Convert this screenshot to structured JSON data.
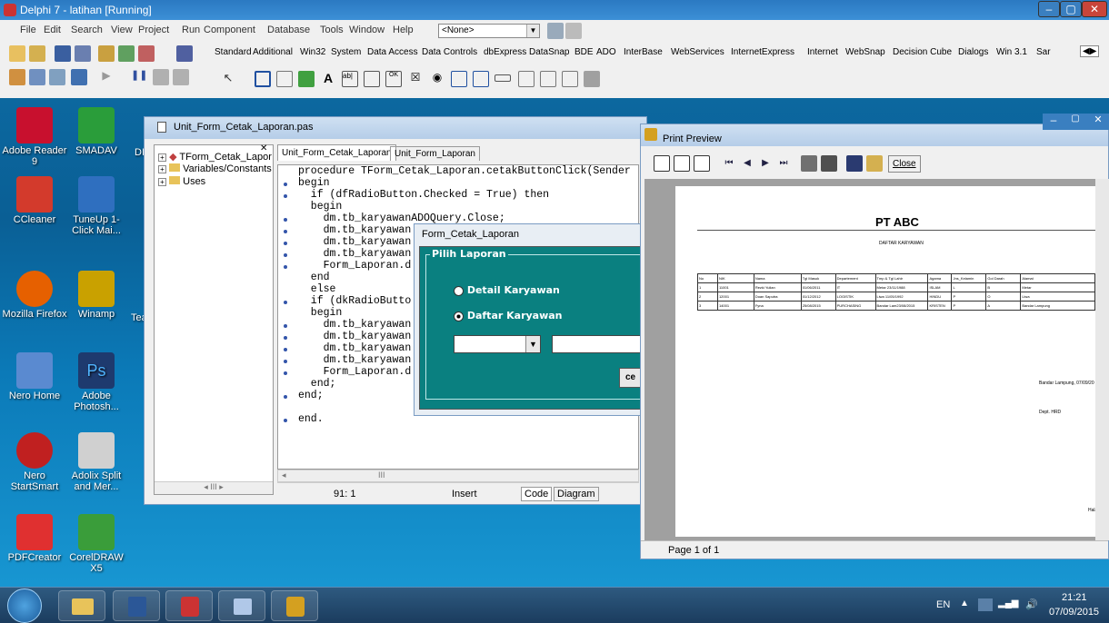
{
  "ide": {
    "title": "Delphi 7 - latihan [Running]",
    "menu": [
      "File",
      "Edit",
      "Search",
      "View",
      "Project",
      "Run",
      "Component",
      "Database",
      "Tools",
      "Window",
      "Help"
    ],
    "desktop_combo": "<None>",
    "palette_tabs": [
      "Standard",
      "Additional",
      "Win32",
      "System",
      "Data Access",
      "Data Controls",
      "dbExpress",
      "DataSnap",
      "BDE",
      "ADO",
      "InterBase",
      "WebServices",
      "InternetExpress",
      "Internet",
      "WebSnap",
      "Decision Cube",
      "Dialogs",
      "Win 3.1",
      "Sar"
    ]
  },
  "desktop_icons": [
    {
      "label": "Adobe Reader 9",
      "color": "#c8102e"
    },
    {
      "label": "SMADAV",
      "color": "#2a9d3a"
    },
    {
      "label": "CCleaner",
      "color": "#d33a2c"
    },
    {
      "label": "TuneUp 1-Click Mai...",
      "color": "#2f6fbf"
    },
    {
      "label": "Mozilla Firefox",
      "color": "#e66000"
    },
    {
      "label": "Winamp",
      "color": "#c9a100"
    },
    {
      "label": "Nero Home",
      "color": "#5a8ad0"
    },
    {
      "label": "Adobe Photosh...",
      "color": "#1e3a6e"
    },
    {
      "label": "Nero StartSmart",
      "color": "#c02020"
    },
    {
      "label": "Adolix Split and Mer...",
      "color": "#d0d0d0"
    },
    {
      "label": "PDFCreator",
      "color": "#e03030"
    },
    {
      "label": "CorelDRAW X5",
      "color": "#3a9d3a"
    }
  ],
  "desktop_partial": [
    "DI",
    "Tea"
  ],
  "editor": {
    "title": "Unit_Form_Cetak_Laporan.pas",
    "tree": [
      "TForm_Cetak_Lapor",
      "Variables/Constants",
      "Uses"
    ],
    "tabs": [
      "Unit_Form_Cetak_Laporan",
      "Unit_Form_Laporan"
    ],
    "code": [
      "procedure TForm_Cetak_Laporan.cetakButtonClick(Sender",
      "begin",
      "  if (dfRadioButton.Checked = True) then",
      "  begin",
      "    dm.tb_karyawanADOQuery.Close;",
      "    dm.tb_karyawan",
      "    dm.tb_karyawan",
      "    dm.tb_karyawan",
      "    Form_Laporan.d",
      "  end",
      "  else",
      "  if (dkRadioButto",
      "  begin",
      "    dm.tb_karyawan",
      "    dm.tb_karyawan",
      "    dm.tb_karyawan",
      "    dm.tb_karyawan",
      "    Form_Laporan.d",
      "  end;",
      "end;",
      "",
      "end."
    ],
    "status_pos": "91: 1",
    "status_mode": "Insert",
    "bottom_tabs": [
      "Code",
      "Diagram"
    ],
    "scroll_mark": "III"
  },
  "form": {
    "title": "Form_Cetak_Laporan",
    "group": "Pilih Laporan",
    "radio1": "Detail Karyawan",
    "radio2": "Daftar Karyawan",
    "button_partial": "ce"
  },
  "preview": {
    "title": "Print Preview",
    "close": "Close",
    "company": "PT ABC",
    "subtitle": "DAFTAR KARYAWAN",
    "headers": [
      "No",
      "NIK",
      "Nama",
      "Tgl Masuk",
      "Departement",
      "Tmp & Tgl Lahir",
      "Agama",
      "Jns_Kelamin",
      "Gol Darah",
      "Alamat",
      "Ot"
    ],
    "rows": [
      [
        "1",
        "11001",
        "Rezki Yulian",
        "01/06/2011",
        "IT",
        "Metar   23/11/1988",
        "ISLAM",
        "L",
        "B",
        "Metar",
        "OE"
      ],
      [
        "2",
        "12001",
        "Doan Saputra",
        "01/12/2012",
        "LOGISTIK",
        "Liwa    11/05/1992",
        "HINDU",
        "P",
        "O",
        "Liwa",
        "OE"
      ],
      [
        "3",
        "14001",
        "Fyna",
        "25/08/2015",
        "PURCHASING",
        "Bandar Lam23/08/2015",
        "KRISTEN",
        "P",
        "A",
        "Bandar Lampung",
        "OE"
      ]
    ],
    "place_date": "Bandar Lampung, 07/09/20",
    "dept": "Dept. HRD",
    "halaman": "Halaman",
    "page_status": "Page 1 of 1"
  },
  "taskbar": {
    "lang": "EN",
    "time": "21:21",
    "date": "07/09/2015"
  }
}
